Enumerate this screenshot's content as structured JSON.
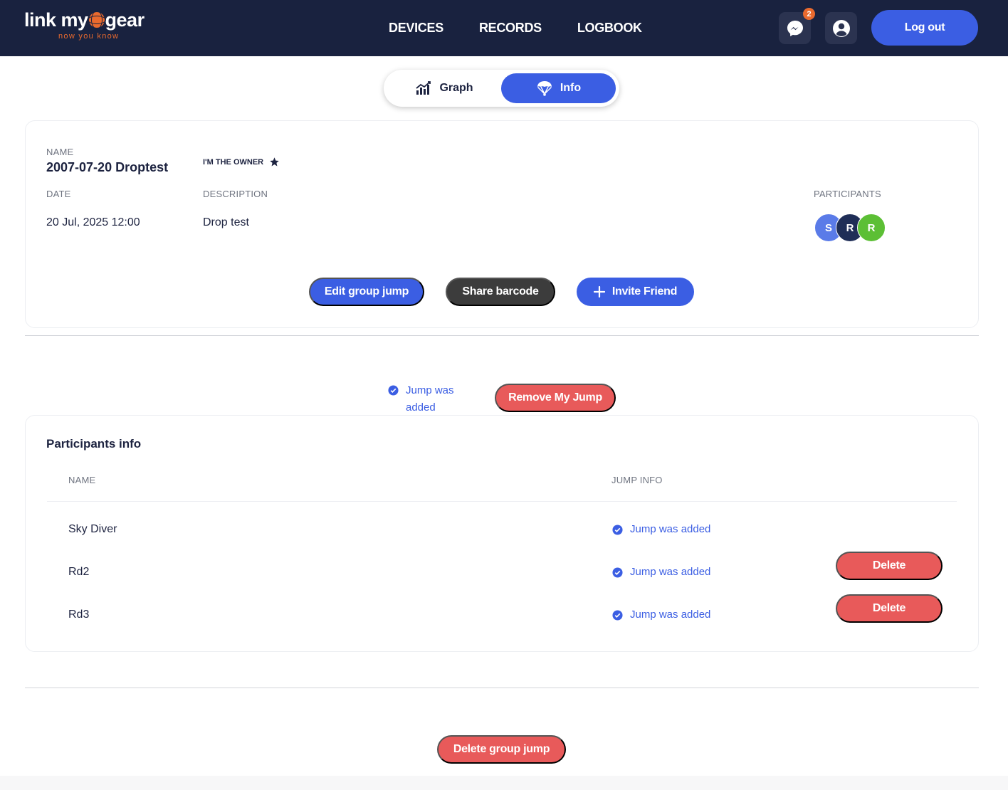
{
  "header": {
    "logo_main_left": "link my",
    "logo_main_right": "gear",
    "logo_tagline": "now you know",
    "nav": [
      "DEVICES",
      "RECORDS",
      "LOGBOOK"
    ],
    "messages_badge": "2",
    "logout_label": "Log out",
    "colors": {
      "background": "#19223f",
      "accent": "#3b5ee3",
      "brand_orange": "#ea6a2e"
    }
  },
  "toggle": {
    "graph_label": "Graph",
    "info_label": "Info",
    "active": "Info"
  },
  "group_jump": {
    "name_label": "NAME",
    "name": "2007-07-20 Droptest",
    "owner_label": "I'M THE OWNER",
    "date_label": "DATE",
    "date": "20 Jul, 2025 12:00",
    "description_label": "DESCRIPTION",
    "description": "Drop test",
    "participants_label": "PARTICIPANTS",
    "participants": [
      {
        "initial": "S",
        "color": "#5a7be8"
      },
      {
        "initial": "R",
        "color": "#1f2e57"
      },
      {
        "initial": "R",
        "color": "#5cbf35"
      }
    ],
    "edit_label": "Edit group jump",
    "share_label": "Share barcode",
    "invite_label": "Invite Friend"
  },
  "my_jump": {
    "status": "Jump was added",
    "remove_label": "Remove My Jump"
  },
  "participants_info": {
    "title": "Participants info",
    "col_name": "NAME",
    "col_jump": "JUMP INFO",
    "rows": [
      {
        "name": "Sky Diver",
        "status": "Jump was added"
      },
      {
        "name": "Rd2",
        "status": "Jump was added",
        "action": "Delete"
      },
      {
        "name": "Rd3",
        "status": "Jump was added",
        "action": "Delete"
      }
    ]
  },
  "delete_group_label": "Delete group jump",
  "colors": {
    "danger": "#e85a5a",
    "dark_button": "#3c3c3c",
    "link_blue": "#3b5ee3"
  }
}
